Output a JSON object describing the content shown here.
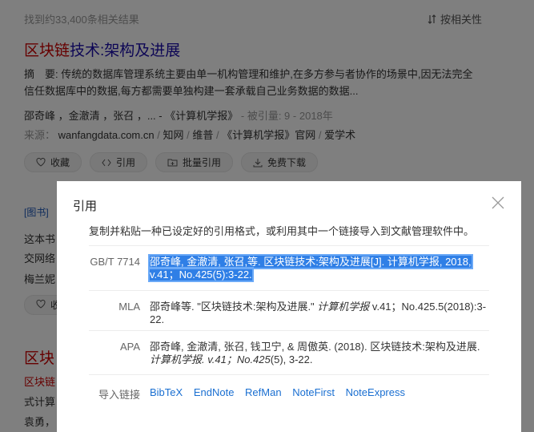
{
  "results": {
    "count_text": "找到约33,400条相关结果",
    "sort_label": "按相关性"
  },
  "result1": {
    "title_a": "区块链",
    "title_b": "技术:架构及进展",
    "abstract_label": "摘　要:",
    "abstract_line1": "传统的数据库管理系统主要由单一机构管理和维护,在多方参与者协作的场景中,因无法完全",
    "abstract_line2": "信任数据库中的数据,每方都需要单独构建一套承载自己业务数据的数据...",
    "authors": "邵奇峰 ，金澈清 ，张召 ，... -",
    "journal": "《计算机学报》",
    "cited": "- 被引量: 9 -",
    "year": "2018年",
    "source_label": "来源：",
    "sources": [
      "wanfangdata.com.cn",
      "知网",
      "维普",
      "《计算机学报》官网",
      "爱学术"
    ],
    "buttons": [
      "收藏",
      "引用",
      "批量引用",
      "免费下载"
    ]
  },
  "result2": {
    "tag": "[图书]",
    "line1": "这本书",
    "line2": "交网络",
    "line3": "梅兰妮",
    "fav_button": "收"
  },
  "result3": {
    "title": "区块",
    "line1": "区块链",
    "line2": "式计算",
    "line3": "袁勇，"
  },
  "modal": {
    "title": "引用",
    "description": "复制并粘贴一种已设定好的引用格式，或利用其中一个链接导入到文献管理软件中。",
    "citations": [
      {
        "style": "GB/T 7714",
        "text_line1": "邵奇峰, 金澈清, 张召,等. 区块链技术:架构及进展[J]. 计算机学报, 2018,",
        "text_line2": "v.41；No.425(5):3-22."
      },
      {
        "style": "MLA",
        "text_a": "邵奇峰等. \"区块链技术:架构及进展.\" ",
        "text_italic": "计算机学报",
        "text_b": " v.41；No.425.5(2018):3-",
        "text_line2": "22."
      },
      {
        "style": "APA",
        "text_line1": "邵奇峰, 金澈清, 张召, 钱卫宁, & 周傲英. (2018). 区块链技术:架构及进展.",
        "text_italic": "计算机学报. v.41；No.425",
        "text_b": "(5), 3-22."
      }
    ],
    "import_label": "导入链接",
    "import_links": [
      "BibTeX",
      "EndNote",
      "RefMan",
      "NoteFirst",
      "NoteExpress"
    ]
  }
}
